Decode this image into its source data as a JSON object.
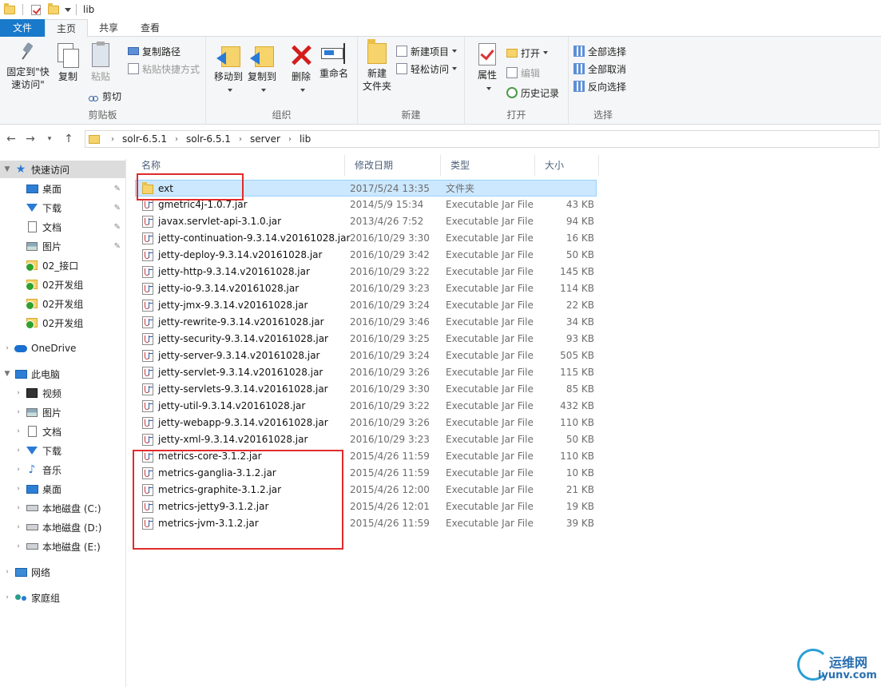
{
  "window": {
    "title": "lib"
  },
  "tabs": [
    "文件",
    "主页",
    "共享",
    "查看"
  ],
  "ribbon": {
    "clipboard": {
      "pin": "固定到\"快\n速访问\"",
      "pin1": "固定到\"快",
      "pin2": "速访问\"",
      "copy": "复制",
      "paste": "粘贴",
      "copy_path": "复制路径",
      "paste_shortcut": "粘贴快捷方式",
      "cut": "剪切",
      "label": "剪贴板"
    },
    "organize": {
      "move_to": "移动到",
      "copy_to": "复制到",
      "delete": "删除",
      "rename": "重命名",
      "label": "组织"
    },
    "new": {
      "new_folder1": "新建",
      "new_folder2": "文件夹",
      "new_item": "新建项目",
      "easy_access": "轻松访问",
      "label": "新建"
    },
    "open": {
      "properties": "属性",
      "open": "打开",
      "edit": "编辑",
      "history": "历史记录",
      "label": "打开"
    },
    "select": {
      "select_all": "全部选择",
      "select_none": "全部取消",
      "invert": "反向选择",
      "label": "选择"
    }
  },
  "address": {
    "crumbs": [
      "solr-6.5.1",
      "solr-6.5.1",
      "server",
      "lib"
    ]
  },
  "nav": {
    "quick_access": "快速访问",
    "quick_items": [
      "桌面",
      "下载",
      "文档",
      "图片",
      "02_接口",
      "02开发组",
      "02开发组",
      "02开发组"
    ],
    "onedrive": "OneDrive",
    "this_pc": "此电脑",
    "pc_items": [
      "视频",
      "图片",
      "文档",
      "下载",
      "音乐",
      "桌面",
      "本地磁盘 (C:)",
      "本地磁盘 (D:)",
      "本地磁盘 (E:)"
    ],
    "network": "网络",
    "homegroup": "家庭组"
  },
  "columns": {
    "name": "名称",
    "date": "修改日期",
    "type": "类型",
    "size": "大小"
  },
  "files": [
    {
      "name": "ext",
      "date": "2017/5/24 13:35",
      "type": "文件夹",
      "size": "",
      "kind": "folder"
    },
    {
      "name": "gmetric4j-1.0.7.jar",
      "date": "2014/5/9 15:34",
      "type": "Executable Jar File",
      "size": "43 KB",
      "kind": "jar"
    },
    {
      "name": "javax.servlet-api-3.1.0.jar",
      "date": "2013/4/26 7:52",
      "type": "Executable Jar File",
      "size": "94 KB",
      "kind": "jar"
    },
    {
      "name": "jetty-continuation-9.3.14.v20161028.jar",
      "date": "2016/10/29 3:30",
      "type": "Executable Jar File",
      "size": "16 KB",
      "kind": "jar"
    },
    {
      "name": "jetty-deploy-9.3.14.v20161028.jar",
      "date": "2016/10/29 3:42",
      "type": "Executable Jar File",
      "size": "50 KB",
      "kind": "jar"
    },
    {
      "name": "jetty-http-9.3.14.v20161028.jar",
      "date": "2016/10/29 3:22",
      "type": "Executable Jar File",
      "size": "145 KB",
      "kind": "jar"
    },
    {
      "name": "jetty-io-9.3.14.v20161028.jar",
      "date": "2016/10/29 3:23",
      "type": "Executable Jar File",
      "size": "114 KB",
      "kind": "jar"
    },
    {
      "name": "jetty-jmx-9.3.14.v20161028.jar",
      "date": "2016/10/29 3:24",
      "type": "Executable Jar File",
      "size": "22 KB",
      "kind": "jar"
    },
    {
      "name": "jetty-rewrite-9.3.14.v20161028.jar",
      "date": "2016/10/29 3:46",
      "type": "Executable Jar File",
      "size": "34 KB",
      "kind": "jar"
    },
    {
      "name": "jetty-security-9.3.14.v20161028.jar",
      "date": "2016/10/29 3:25",
      "type": "Executable Jar File",
      "size": "93 KB",
      "kind": "jar"
    },
    {
      "name": "jetty-server-9.3.14.v20161028.jar",
      "date": "2016/10/29 3:24",
      "type": "Executable Jar File",
      "size": "505 KB",
      "kind": "jar"
    },
    {
      "name": "jetty-servlet-9.3.14.v20161028.jar",
      "date": "2016/10/29 3:26",
      "type": "Executable Jar File",
      "size": "115 KB",
      "kind": "jar"
    },
    {
      "name": "jetty-servlets-9.3.14.v20161028.jar",
      "date": "2016/10/29 3:30",
      "type": "Executable Jar File",
      "size": "85 KB",
      "kind": "jar"
    },
    {
      "name": "jetty-util-9.3.14.v20161028.jar",
      "date": "2016/10/29 3:22",
      "type": "Executable Jar File",
      "size": "432 KB",
      "kind": "jar"
    },
    {
      "name": "jetty-webapp-9.3.14.v20161028.jar",
      "date": "2016/10/29 3:26",
      "type": "Executable Jar File",
      "size": "110 KB",
      "kind": "jar"
    },
    {
      "name": "jetty-xml-9.3.14.v20161028.jar",
      "date": "2016/10/29 3:23",
      "type": "Executable Jar File",
      "size": "50 KB",
      "kind": "jar"
    },
    {
      "name": "metrics-core-3.1.2.jar",
      "date": "2015/4/26 11:59",
      "type": "Executable Jar File",
      "size": "110 KB",
      "kind": "jar"
    },
    {
      "name": "metrics-ganglia-3.1.2.jar",
      "date": "2015/4/26 11:59",
      "type": "Executable Jar File",
      "size": "10 KB",
      "kind": "jar"
    },
    {
      "name": "metrics-graphite-3.1.2.jar",
      "date": "2015/4/26 12:00",
      "type": "Executable Jar File",
      "size": "21 KB",
      "kind": "jar"
    },
    {
      "name": "metrics-jetty9-3.1.2.jar",
      "date": "2015/4/26 12:01",
      "type": "Executable Jar File",
      "size": "19 KB",
      "kind": "jar"
    },
    {
      "name": "metrics-jvm-3.1.2.jar",
      "date": "2015/4/26 11:59",
      "type": "Executable Jar File",
      "size": "39 KB",
      "kind": "jar"
    }
  ],
  "selected_file": "ext",
  "watermark": {
    "cn": "运维网",
    "en": "iyunv.com"
  },
  "colors": {
    "accent": "#1979ca",
    "selection": "#cce8ff",
    "highlight_box": "#e02b2b"
  }
}
